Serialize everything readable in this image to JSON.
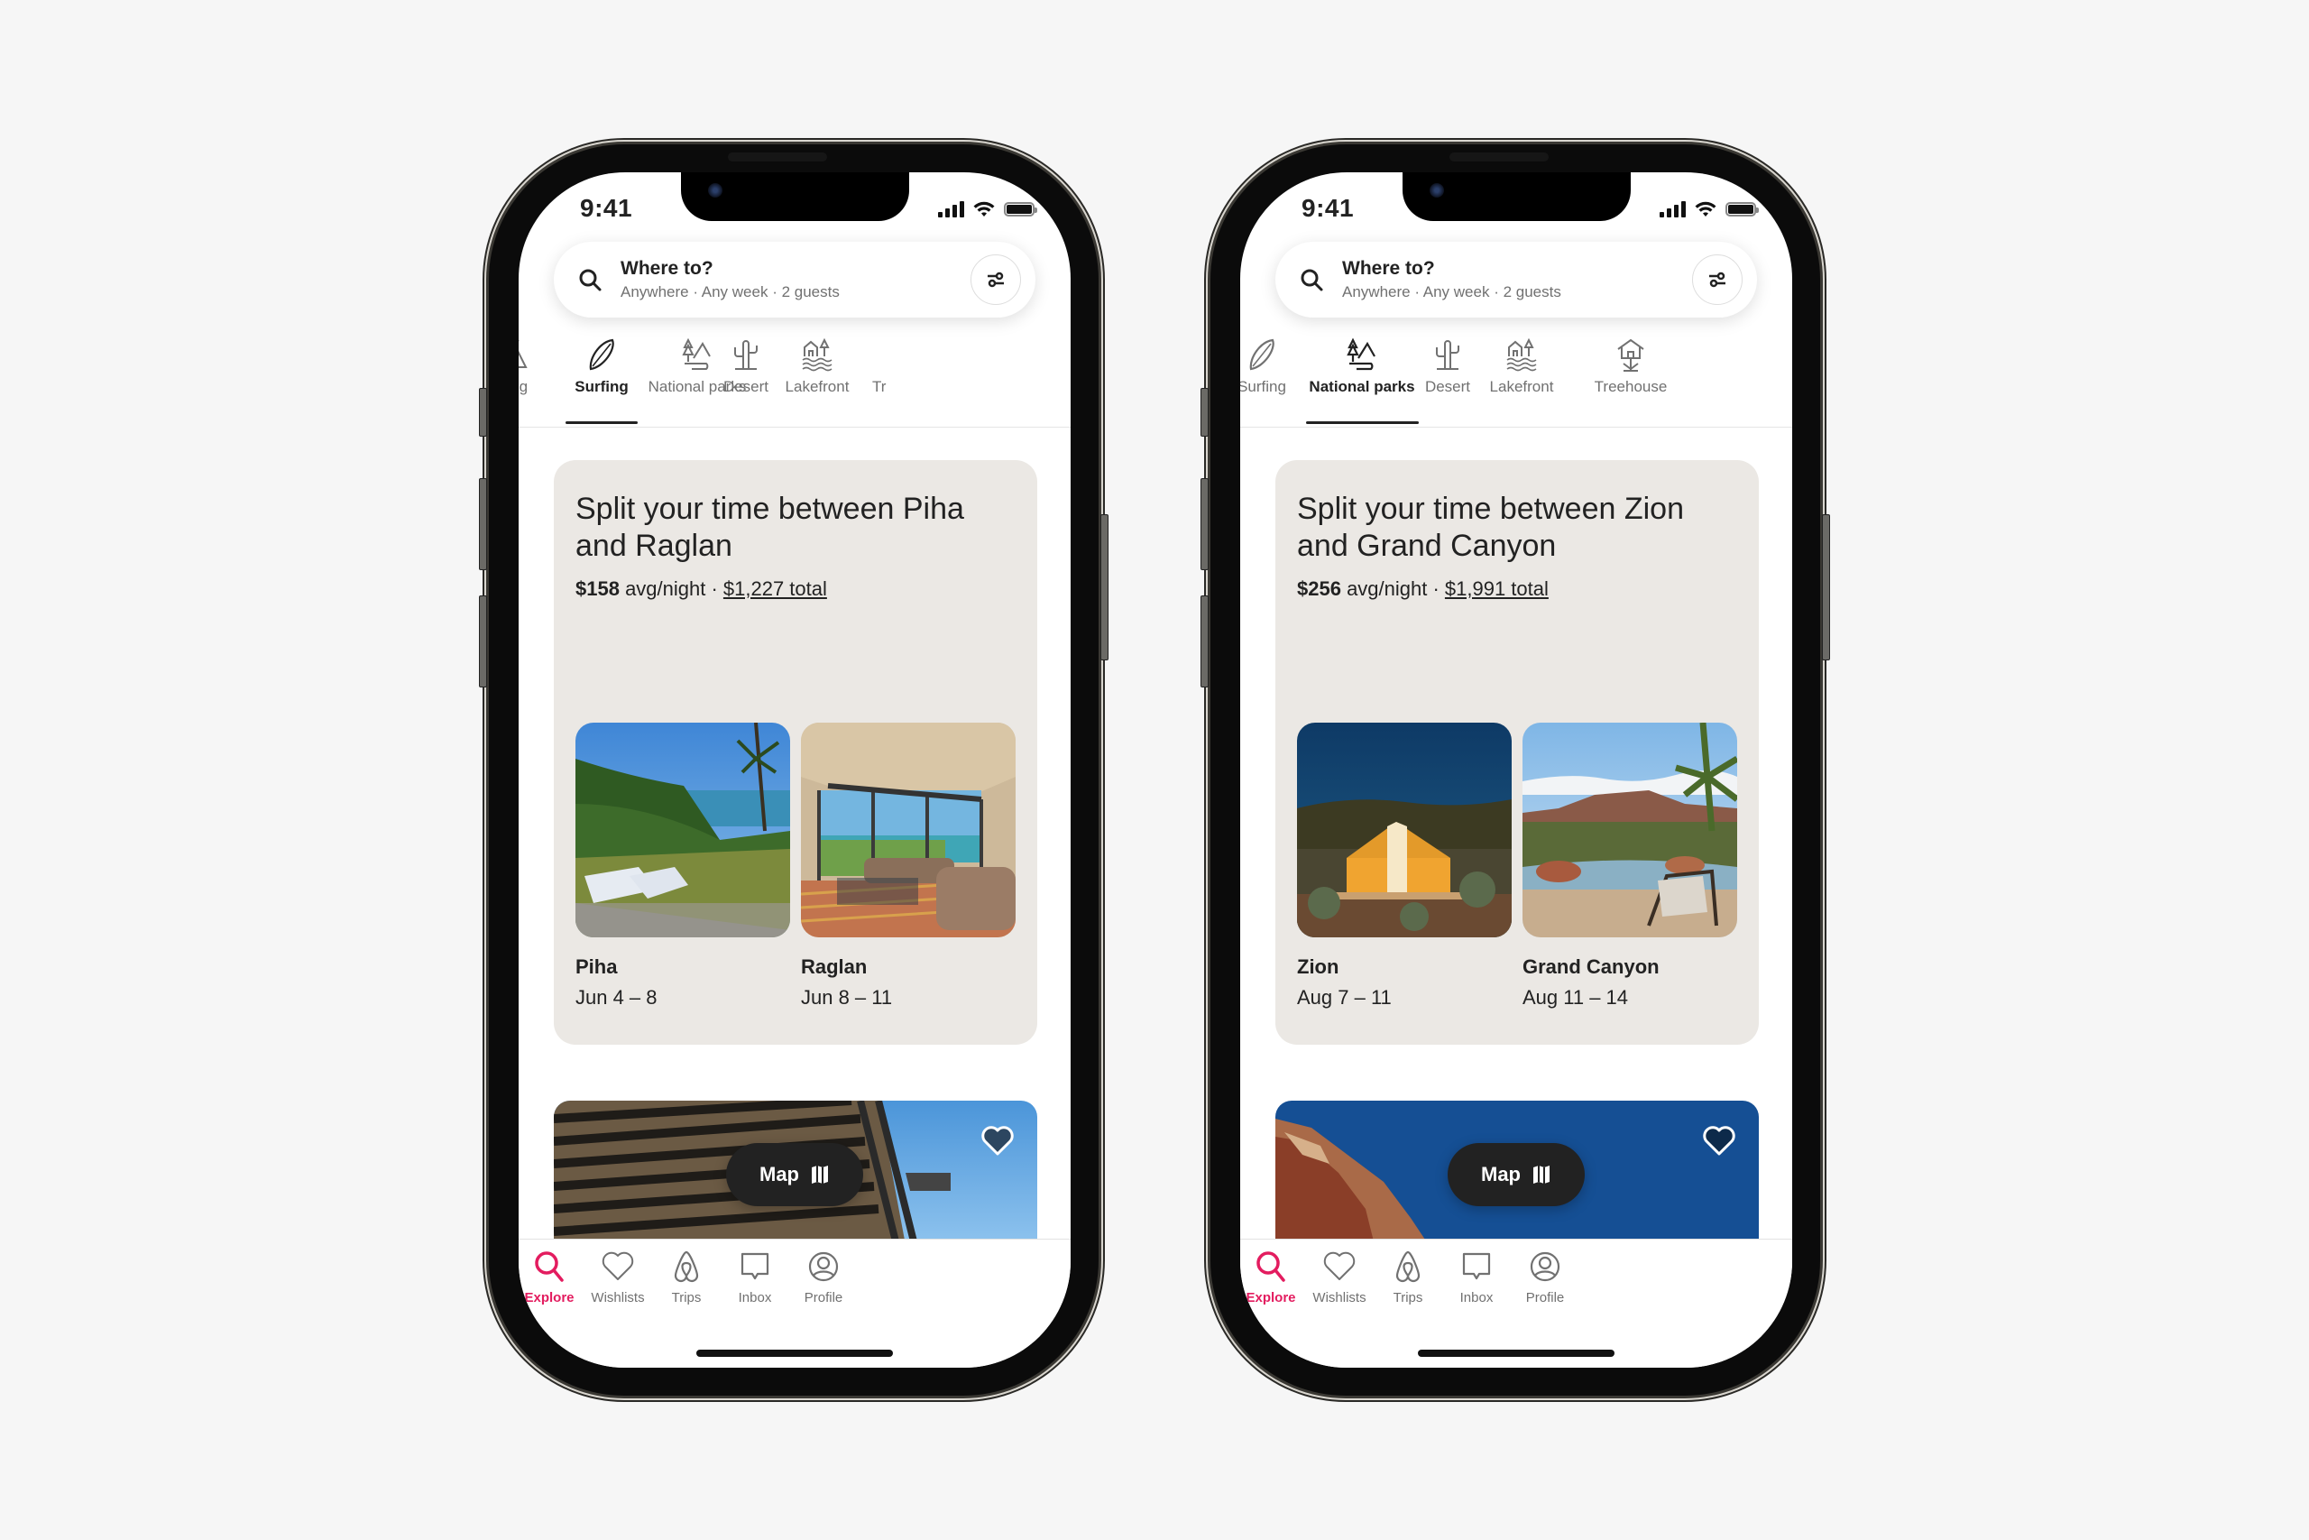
{
  "colors": {
    "background": "#f6f6f6",
    "accent": "#e31c5f",
    "card_bg": "#ebe8e4",
    "text_primary": "#222222",
    "text_secondary": "#717171"
  },
  "phones": [
    {
      "status": {
        "time": "9:41",
        "icons": [
          "signal-icon",
          "wifi-icon",
          "battery-icon"
        ]
      },
      "search": {
        "title": "Where to?",
        "subtitle": "Anywhere · Any week · 2 guests",
        "icon": "search-icon",
        "filter_icon": "filter-icon"
      },
      "categories": [
        {
          "label": "Camping",
          "visible_label": "ping",
          "icon": "tent-icon",
          "active": false
        },
        {
          "label": "Surfing",
          "icon": "surfboard-icon",
          "active": true
        },
        {
          "label": "National parks",
          "icon": "national-park-icon",
          "active": false
        },
        {
          "label": "Desert",
          "icon": "cactus-icon",
          "active": false
        },
        {
          "label": "Lakefront",
          "icon": "lakefront-icon",
          "active": false
        },
        {
          "label": "Treehouse",
          "visible_label": "Tr",
          "icon": "treehouse-icon",
          "active": false
        }
      ],
      "card": {
        "title": "Split your time between Piha and Raglan",
        "price_avg": "$158",
        "price_avg_suffix": " avg/night · ",
        "price_total": "$1,227 total",
        "destinations": [
          {
            "name": "Piha",
            "dates": "Jun 4 – 8",
            "image": "coastal-lawn-with-sun-loungers"
          },
          {
            "name": "Raglan",
            "dates": "Jun 8 – 11",
            "image": "sunroom-living-room-ocean-view"
          }
        ]
      },
      "listing": {
        "image": "wooden-pergola-blue-sky",
        "wishlist_icon": "heart-icon"
      },
      "map_button": {
        "label": "Map",
        "icon": "map-icon"
      },
      "nav": [
        {
          "label": "Explore",
          "icon": "search-icon",
          "active": true
        },
        {
          "label": "Wishlists",
          "icon": "heart-icon",
          "active": false
        },
        {
          "label": "Trips",
          "icon": "airbnb-logo-icon",
          "active": false
        },
        {
          "label": "Inbox",
          "icon": "message-icon",
          "active": false
        },
        {
          "label": "Profile",
          "icon": "profile-icon",
          "active": false
        }
      ]
    },
    {
      "status": {
        "time": "9:41",
        "icons": [
          "signal-icon",
          "wifi-icon",
          "battery-icon"
        ]
      },
      "search": {
        "title": "Where to?",
        "subtitle": "Anywhere · Any week · 2 guests",
        "icon": "search-icon",
        "filter_icon": "filter-icon"
      },
      "categories": [
        {
          "label": "Surfing",
          "icon": "surfboard-icon",
          "active": false
        },
        {
          "label": "National parks",
          "icon": "national-park-icon",
          "active": true
        },
        {
          "label": "Desert",
          "icon": "cactus-icon",
          "active": false
        },
        {
          "label": "Lakefront",
          "icon": "lakefront-icon",
          "active": false
        },
        {
          "label": "Treehouse",
          "icon": "treehouse-icon",
          "active": false
        }
      ],
      "card": {
        "title": "Split your time between Zion and Grand Canyon",
        "price_avg": "$256",
        "price_avg_suffix": " avg/night · ",
        "price_total": "$1,991 total",
        "destinations": [
          {
            "name": "Zion",
            "dates": "Aug 7 – 11",
            "image": "glamping-tent-at-dusk"
          },
          {
            "name": "Grand Canyon",
            "dates": "Aug 11 – 14",
            "image": "infinity-pool-mesa-view"
          }
        ]
      },
      "listing": {
        "image": "red-rock-cliff-blue-sky",
        "wishlist_icon": "heart-icon"
      },
      "map_button": {
        "label": "Map",
        "icon": "map-icon"
      },
      "nav": [
        {
          "label": "Explore",
          "icon": "search-icon",
          "active": true
        },
        {
          "label": "Wishlists",
          "icon": "heart-icon",
          "active": false
        },
        {
          "label": "Trips",
          "icon": "airbnb-logo-icon",
          "active": false
        },
        {
          "label": "Inbox",
          "icon": "message-icon",
          "active": false
        },
        {
          "label": "Profile",
          "icon": "profile-icon",
          "active": false
        }
      ]
    }
  ]
}
